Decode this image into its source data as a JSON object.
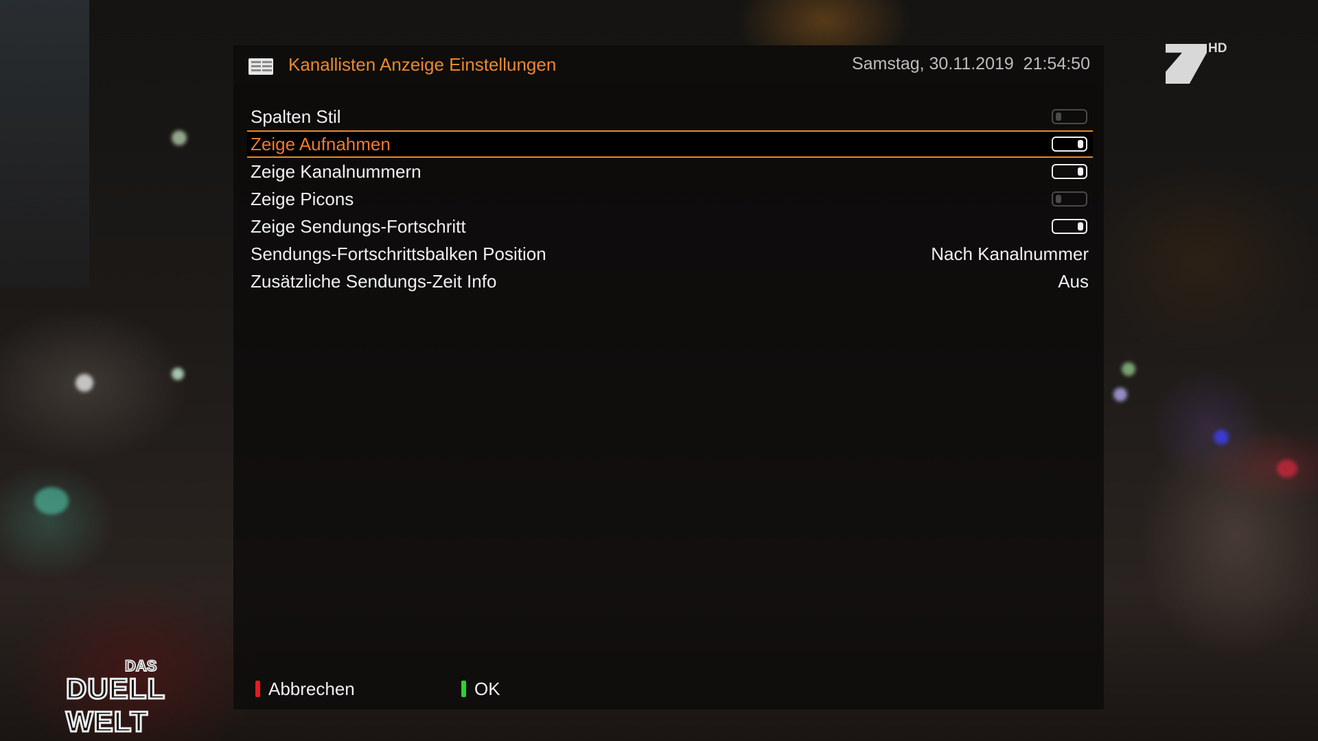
{
  "channel_logo": {
    "hd_label": "HD"
  },
  "show_logo": {
    "top": "DAS",
    "main": "DUELL WELT"
  },
  "header": {
    "title": "Kanallisten Anzeige Einstellungen",
    "datetime": "Samstag, 30.11.2019  21:54:50"
  },
  "settings": [
    {
      "label": "Spalten Stil",
      "type": "toggle",
      "state": "off"
    },
    {
      "label": "Zeige Aufnahmen",
      "type": "toggle",
      "state": "on",
      "selected": true
    },
    {
      "label": "Zeige Kanalnummern",
      "type": "toggle",
      "state": "on"
    },
    {
      "label": "Zeige Picons",
      "type": "toggle",
      "state": "off"
    },
    {
      "label": "Zeige Sendungs-Fortschritt",
      "type": "toggle",
      "state": "on"
    },
    {
      "label": "Sendungs-Fortschrittsbalken Position",
      "type": "value",
      "value": "Nach Kanalnummer"
    },
    {
      "label": "Zusätzliche Sendungs-Zeit Info",
      "type": "value",
      "value": "Aus"
    }
  ],
  "footer": {
    "red": {
      "label": "Abbrechen",
      "color": "#e01e1e"
    },
    "green": {
      "label": "OK",
      "color": "#2ed12e"
    }
  },
  "colors": {
    "accent": "#e8892e",
    "selected_text": "#f07a2a"
  }
}
